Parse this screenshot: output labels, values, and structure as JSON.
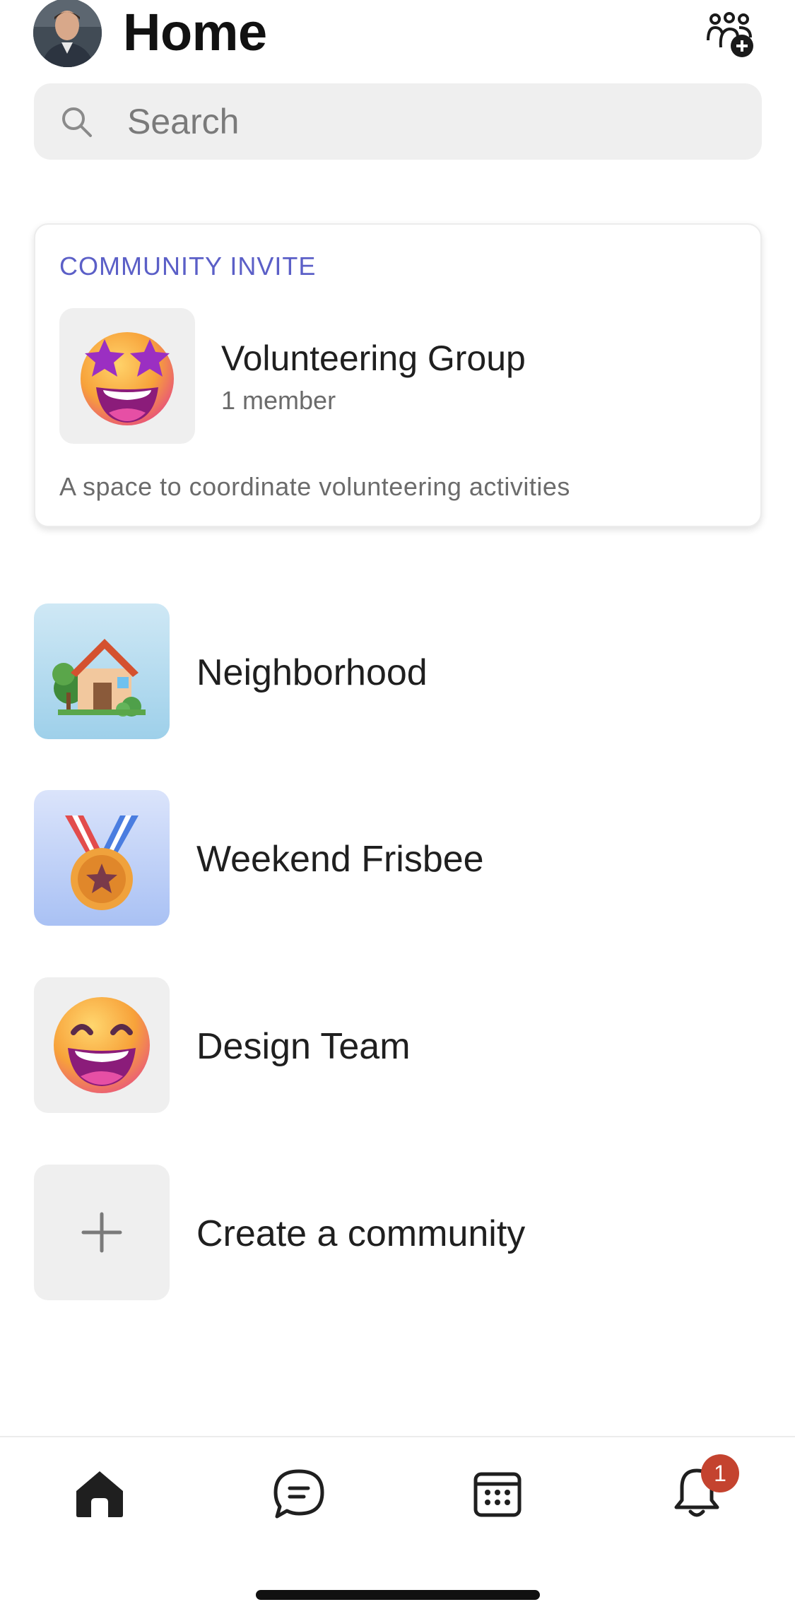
{
  "header": {
    "title": "Home",
    "avatar_icon": "user-avatar",
    "action_icon": "add-community-icon"
  },
  "search": {
    "placeholder": "Search",
    "icon": "search-icon"
  },
  "invite": {
    "kicker": "COMMUNITY INVITE",
    "name": "Volunteering Group",
    "members": "1 member",
    "description": "A space to coordinate volunteering activities",
    "icon": "star-struck-emoji-icon"
  },
  "communities": [
    {
      "label": "Neighborhood",
      "icon": "house-icon"
    },
    {
      "label": "Weekend Frisbee",
      "icon": "medal-icon"
    },
    {
      "label": "Design Team",
      "icon": "grinning-emoji-icon"
    },
    {
      "label": "Create a community",
      "icon": "plus-icon"
    }
  ],
  "nav": {
    "items": [
      {
        "name": "home",
        "icon": "home-icon",
        "active": true
      },
      {
        "name": "chat",
        "icon": "chat-icon"
      },
      {
        "name": "calendar",
        "icon": "calendar-icon"
      },
      {
        "name": "notifications",
        "icon": "bell-icon"
      }
    ],
    "notification_badge": "1"
  },
  "colors": {
    "accent": "#5b5fc7",
    "badge": "#c4432f",
    "surface": "#efefef"
  }
}
